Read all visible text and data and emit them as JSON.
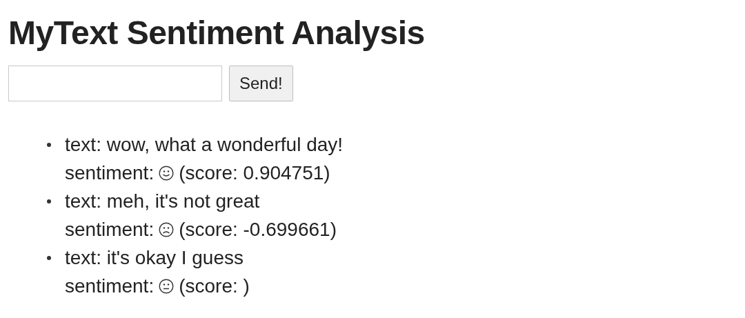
{
  "title": "MyText Sentiment Analysis",
  "form": {
    "button": "Send!"
  },
  "results": [
    {
      "text": "text: wow, what a wonderful day!",
      "sentiment_label": "sentiment:",
      "kind": "positive",
      "score": "(score: 0.904751)"
    },
    {
      "text": "text: meh, it's not great",
      "sentiment_label": "sentiment:",
      "kind": "negative",
      "score": "(score: -0.699661)"
    },
    {
      "text": "text: it's okay I guess",
      "sentiment_label": "sentiment:",
      "kind": "neutral",
      "score": "(score: )"
    }
  ]
}
